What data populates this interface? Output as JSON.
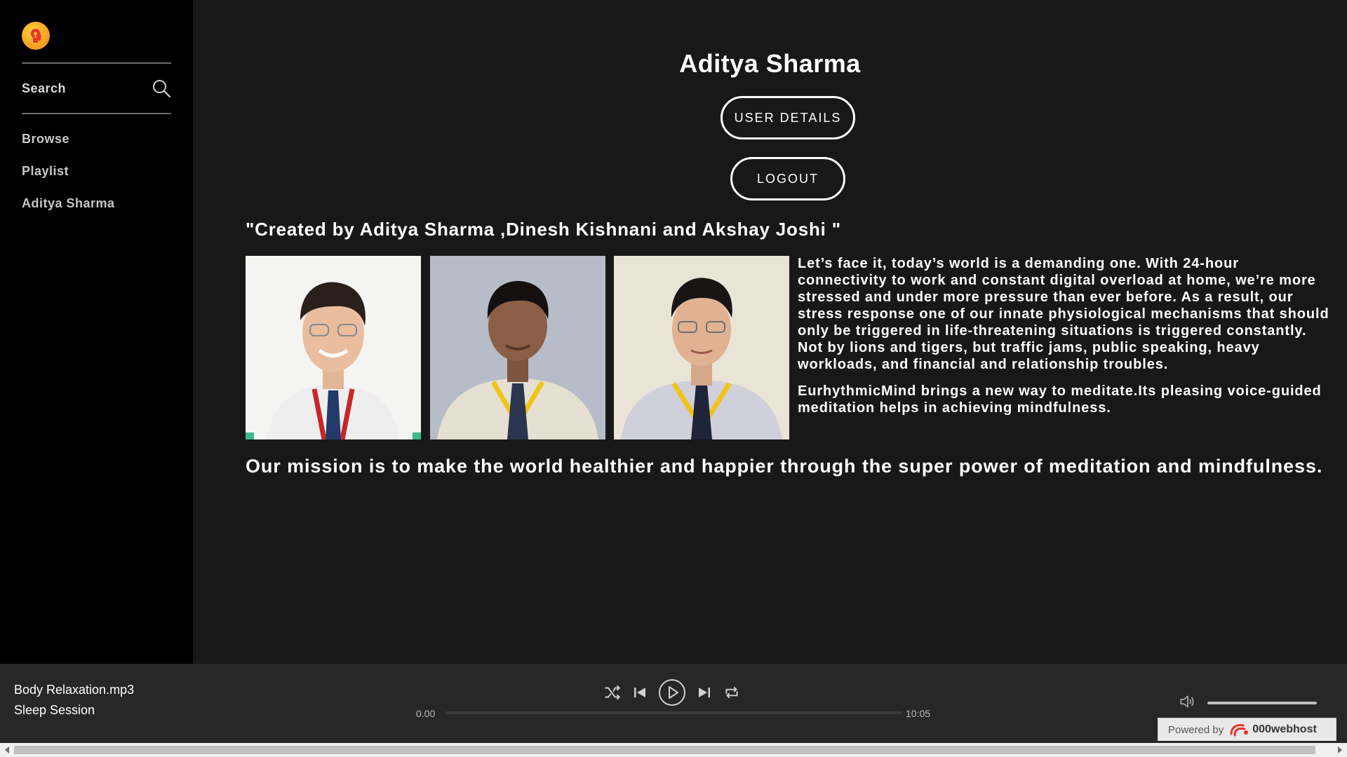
{
  "sidebar": {
    "logo_icon": "meditation-head-icon",
    "search_label": "Search",
    "search_icon": "search-icon",
    "items": [
      {
        "label": "Browse"
      },
      {
        "label": "Playlist"
      },
      {
        "label": "Aditya Sharma"
      }
    ]
  },
  "main": {
    "profile_name": "Aditya Sharma",
    "user_details_label": "USER DETAILS",
    "logout_label": "LOGOUT",
    "credits": "\"Created by Aditya Sharma ,Dinesh Kishnani and Akshay Joshi \"",
    "about_paragraphs": [
      "Let’s face it, today’s world is a demanding one. With 24-hour connectivity to work and constant digital overload at home, we’re more stressed and under more pressure than ever before. As a result, our stress response one of our innate physiological mechanisms that should only be triggered in life-threatening situations is triggered constantly. Not by lions and tigers, but traffic jams, public speaking, heavy workloads, and financial and relationship troubles.",
      "EurhythmicMind brings a new way to meditate.Its pleasing voice-guided meditation helps in achieving mindfulness."
    ],
    "mission": "Our mission is to make the world healthier and happier through the super power of meditation and mindfulness."
  },
  "player": {
    "track_title": "Body Relaxation.mp3",
    "track_subtitle": "Sleep Session",
    "time_current": "0.00",
    "time_total": "10:05",
    "progress_fraction": 0.0,
    "volume_fraction": 1.0,
    "icons": [
      "shuffle-icon",
      "previous-icon",
      "play-icon",
      "next-icon",
      "repeat-icon",
      "volume-icon"
    ]
  },
  "footer": {
    "powered_by": "Powered by",
    "brand": "000webhost"
  },
  "colors": {
    "sidebar_bg": "#000000",
    "main_bg": "#181818",
    "player_bg": "#272727",
    "logo_accent": "#f5a623"
  }
}
